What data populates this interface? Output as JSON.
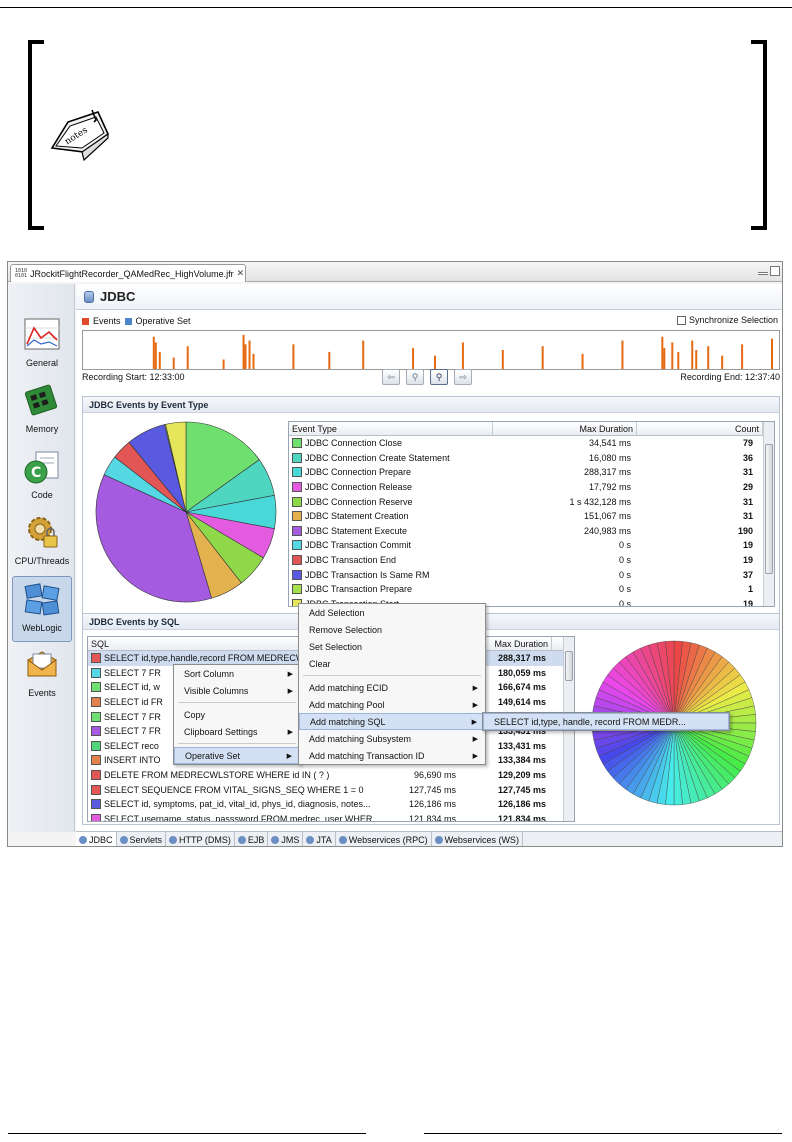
{
  "window": {
    "tab_title": "JRockitFlightRecorder_QAMedRec_HighVolume.jfr",
    "tab_icon_text": "1010 0101"
  },
  "nav": [
    {
      "label": "General",
      "icon": "chart-icon"
    },
    {
      "label": "Memory",
      "icon": "memory-chip-icon"
    },
    {
      "label": "Code",
      "icon": "code-icon"
    },
    {
      "label": "CPU/Threads",
      "icon": "gear-lock-icon"
    },
    {
      "label": "WebLogic",
      "icon": "weblogic-icon"
    },
    {
      "label": "Events",
      "icon": "events-icon"
    }
  ],
  "header": {
    "title": "JDBC"
  },
  "timeline": {
    "legend_events": "Events",
    "legend_operative": "Operative Set",
    "sync_label": "Synchronize Selection",
    "recording_start": "Recording Start: 12:33:00",
    "recording_end": "Recording End: 12:37:40",
    "buttons": [
      "⇦",
      "⚲",
      "⚲",
      "⇨"
    ]
  },
  "events_by_type": {
    "title": "JDBC Events by Event Type",
    "columns": [
      "Event Type",
      "Max Duration",
      "Count"
    ],
    "rows": [
      {
        "type": "JDBC Connection Close",
        "max": "34,541 ms",
        "count": "79",
        "color": "#6fe06f"
      },
      {
        "type": "JDBC Connection Create Statement",
        "max": "16,080 ms",
        "count": "36",
        "color": "#4fd6c0"
      },
      {
        "type": "JDBC Connection Prepare",
        "max": "288,317 ms",
        "count": "31",
        "color": "#49d8d8"
      },
      {
        "type": "JDBC Connection Release",
        "max": "17,792 ms",
        "count": "29",
        "color": "#e35ce0"
      },
      {
        "type": "JDBC Connection Reserve",
        "max": "1 s 432,128 ms",
        "count": "31",
        "color": "#8ed84a"
      },
      {
        "type": "JDBC Statement Creation",
        "max": "151,067 ms",
        "count": "31",
        "color": "#e3b14e"
      },
      {
        "type": "JDBC Statement Execute",
        "max": "240,983 ms",
        "count": "190",
        "color": "#a45be0"
      },
      {
        "type": "JDBC Transaction Commit",
        "max": "0 s",
        "count": "19",
        "color": "#56d8e4"
      },
      {
        "type": "JDBC Transaction End",
        "max": "0 s",
        "count": "19",
        "color": "#e35656"
      },
      {
        "type": "JDBC Transaction Is Same RM",
        "max": "0 s",
        "count": "37",
        "color": "#5a5ae0"
      },
      {
        "type": "JDBC Transaction Prepare",
        "max": "0 s",
        "count": "1",
        "color": "#a6e04e"
      },
      {
        "type": "JDBC Transaction Start",
        "max": "0 s",
        "count": "19",
        "color": "#e6e65a"
      }
    ]
  },
  "events_by_sql": {
    "title": "JDBC Events by SQL",
    "columns": [
      "SQL",
      "",
      "Max Duration"
    ],
    "rows": [
      {
        "sql": "SELECT id,type,handle,record FROM MEDRECW",
        "d1": "",
        "d2": "288,317 ms",
        "color": "#e35656"
      },
      {
        "sql": "SELECT 7 FR",
        "d1": "",
        "d2": "180,059 ms",
        "color": "#56d8e4"
      },
      {
        "sql": "SELECT id, w",
        "d1": "",
        "d2": "166,674 ms",
        "color": "#6fe06f"
      },
      {
        "sql": "SELECT id FR",
        "d1": "",
        "d2": "149,614 ms",
        "color": "#e3844e"
      },
      {
        "sql": "SELECT 7 FR",
        "d1": "",
        "d2": "134,511 ms",
        "color": "#6fe06f"
      },
      {
        "sql": "SELECT 7 FR",
        "d1": "",
        "d2": "133,431 ms",
        "color": "#a45be0"
      },
      {
        "sql": "SELECT reco",
        "d1": "",
        "d2": "133,431 ms",
        "color": "#4fd67a"
      },
      {
        "sql": "INSERT INTO",
        "d1": "",
        "d2": "133,384 ms",
        "color": "#e3844e"
      },
      {
        "sql": "DELETE FROM MEDRECWLSTORE WHERE id IN ( ? )",
        "d1": "96,690 ms",
        "d2": "129,209 ms",
        "color": "#e35656"
      },
      {
        "sql": "SELECT SEQUENCE FROM VITAL_SIGNS_SEQ WHERE 1 = 0",
        "d1": "127,745 ms",
        "d2": "127,745 ms",
        "color": "#e35656"
      },
      {
        "sql": "SELECT id, symptoms, pat_id, vital_id, phys_id, diagnosis, notes...",
        "d1": "126,186 ms",
        "d2": "126,186 ms",
        "color": "#5a5ae0"
      },
      {
        "sql": "SELECT username, status, passsword FROM medrec_user WHER",
        "d1": "121,834 ms",
        "d2": "121,834 ms",
        "color": "#e35ce0"
      }
    ]
  },
  "context_menu_1": {
    "items": [
      {
        "label": "Sort Column",
        "submenu": true
      },
      {
        "label": "Visible Columns",
        "submenu": true
      },
      {
        "sep": true
      },
      {
        "label": "Copy",
        "submenu": false
      },
      {
        "label": "Clipboard Settings",
        "submenu": true
      },
      {
        "sep": true
      },
      {
        "label": "Operative Set",
        "submenu": true,
        "hot": true
      }
    ]
  },
  "context_menu_2": {
    "items": [
      {
        "label": "Add Selection",
        "submenu": false
      },
      {
        "label": "Remove Selection",
        "submenu": false
      },
      {
        "label": "Set Selection",
        "submenu": false
      },
      {
        "label": "Clear",
        "submenu": false
      },
      {
        "sep": true
      },
      {
        "label": "Add matching ECID",
        "submenu": true
      },
      {
        "label": "Add matching Pool",
        "submenu": true
      },
      {
        "label": "Add matching SQL",
        "submenu": true,
        "hot": true
      },
      {
        "label": "Add matching Subsystem",
        "submenu": true
      },
      {
        "label": "Add matching Transaction ID",
        "submenu": true
      }
    ]
  },
  "context_menu_3": {
    "item": "SELECT id,type, handle, record FROM MEDR..."
  },
  "bottom_tabs": [
    "JDBC",
    "Servlets",
    "HTTP (DMS)",
    "EJB",
    "JMS",
    "JTA",
    "Webservices (RPC)",
    "Webservices (WS)"
  ],
  "colors": {
    "events_swatch": "#e04a2a",
    "operative_swatch": "#4a87c9",
    "timeline_bar": "#e56a12",
    "pie_slices": [
      "#6fe06f",
      "#4fd6c0",
      "#49d8d8",
      "#e35ce0",
      "#8ed84a",
      "#e3b14e",
      "#a45be0",
      "#56d8e4",
      "#e35656",
      "#5a5ae0",
      "#a6e04e",
      "#e6e65a"
    ]
  },
  "chart_data": {
    "type": "pie",
    "categories": [
      "JDBC Connection Close",
      "JDBC Connection Create Statement",
      "JDBC Connection Prepare",
      "JDBC Connection Release",
      "JDBC Connection Reserve",
      "JDBC Statement Creation",
      "JDBC Statement Execute",
      "JDBC Transaction Commit",
      "JDBC Transaction End",
      "JDBC Transaction Is Same RM",
      "JDBC Transaction Prepare",
      "JDBC Transaction Start"
    ],
    "values": [
      79,
      36,
      31,
      29,
      31,
      31,
      190,
      19,
      19,
      37,
      1,
      19
    ]
  }
}
